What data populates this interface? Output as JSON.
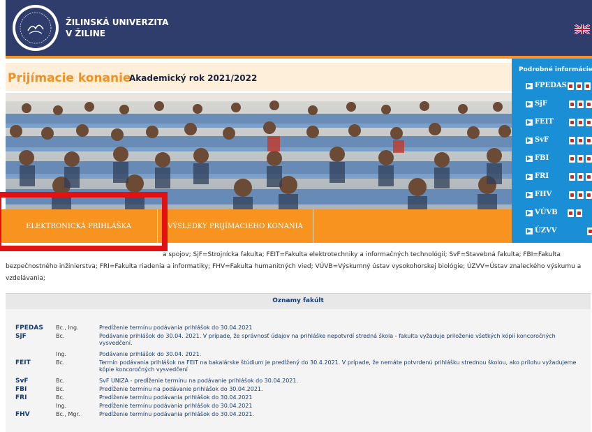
{
  "header": {
    "uni_line1": "ŽILINSKÁ UNIVERZITA",
    "uni_line2": "V ŽILINE",
    "logo_text": "ŽILINSKÁ UNIVERZITA",
    "flag": "uk-flag-icon"
  },
  "page": {
    "title": "Prijímacie konanie",
    "year": "Akademický rok 2021/2022"
  },
  "band": {
    "btn1": "ELEKTRONICKÁ PRIHLÁŠKA",
    "btn2": "VÝSLEDKY PRIJÍMACIEHO KONANIA"
  },
  "sidebar": {
    "title": "Podrobné informácie",
    "items": [
      {
        "label": "FPEDAS",
        "pdfs": 3
      },
      {
        "label": "SjF",
        "pdfs": 3
      },
      {
        "label": "FEIT",
        "pdfs": 3
      },
      {
        "label": "SvF",
        "pdfs": 3
      },
      {
        "label": "FBI",
        "pdfs": 3
      },
      {
        "label": "FRI",
        "pdfs": 3
      },
      {
        "label": "FHV",
        "pdfs": 3
      },
      {
        "label": "VÚVB",
        "pdfs": 2
      },
      {
        "label": "ÚZVV",
        "pdfs": 1
      }
    ]
  },
  "legend": {
    "line1_visible": "a spojov; SjF=Strojnícka fakulta; FEIT=Fakulta elektrotechniky a informačných technológií; SvF=Stavebná fakulta; FBI=Fakulta",
    "line2": "bezpečnostného inžinierstva; FRI=Fakulta riadenia a informatiky; FHV=Fakulta humanitných vied; VÚVB=Výskumný ústav vysokohorskej biológie; ÚZVV=Ústav znaleckého výskumu a",
    "line3": "vzdelávania;"
  },
  "oznamy": {
    "title": "Oznamy fakúlt",
    "rows": [
      {
        "faculty": "FPEDAS",
        "degree": "Bc., Ing.",
        "text": "Predĺženie termínu podávania prihlášok do 30.04.2021"
      },
      {
        "faculty": "SjF",
        "degree": "Bc.",
        "text": "Podávanie prihlášok do 30.04. 2021. V prípade, že správnosť údajov na prihláške nepotvrdí stredná škola - fakulta vyžaduje priloženie všetkých kópií koncoročných vysvedčení."
      },
      {
        "faculty": "",
        "degree": "Ing.",
        "text": "Podávanie prihlášok do 30.04. 2021."
      },
      {
        "faculty": "FEIT",
        "degree": "Bc.",
        "text": "Termín podávania prihlášok na FEIT na bakalárske štúdium je predĺžený do 30.4.2021. V prípade, že nemáte potvrdenú prihlášku strednou školou, ako prílohu vyžadujeme kópie koncoročných vysvedčení"
      },
      {
        "faculty": "SvF",
        "degree": "Bc.",
        "text": "SvF UNIZA - predĺženie termínu na podávanie prihlášok do 30.04.2021."
      },
      {
        "faculty": "FBI",
        "degree": "Bc.",
        "text": "Predĺženie termínu na podávanie prihlášok do 30.04.2021."
      },
      {
        "faculty": "FRI",
        "degree": "Bc.",
        "text": "Predĺženie termínu podávania prihlášok do 30.04.2021"
      },
      {
        "faculty": "",
        "degree": "Ing.",
        "text": "Predĺženie termínu podávania prihlášok do 30.04.2021"
      },
      {
        "faculty": "FHV",
        "degree": "Bc., Mgr.",
        "text": "Predĺženie termínu podávania prihlášok do 30.04.2021."
      }
    ]
  },
  "colors": {
    "navy": "#2e3d6b",
    "orange": "#f7931e",
    "side_blue": "#1a8fd6",
    "highlight_red": "#e21212"
  }
}
